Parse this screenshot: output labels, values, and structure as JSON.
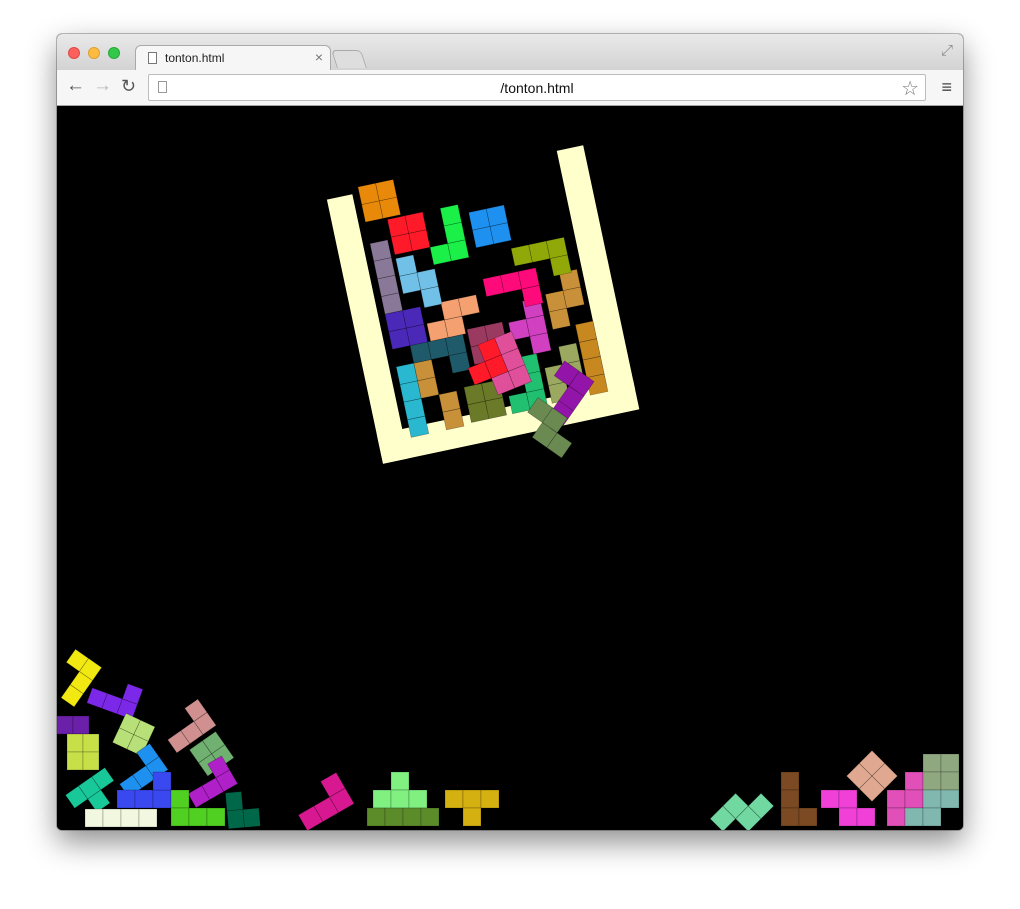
{
  "tab": {
    "title": "tonton.html",
    "close_glyph": "×"
  },
  "address_bar": {
    "url": "/tonton.html"
  },
  "icons": {
    "back": "←",
    "forward": "→",
    "reload": "↻",
    "bookmark_star": "☆",
    "menu": "≡",
    "fullscreen": "⤢"
  },
  "colors": {
    "background": "#000000",
    "container": "#ffffcc",
    "piece_palette": [
      "#e8890a",
      "#ff1a2a",
      "#e0509a",
      "#9314a8",
      "#6a8a52",
      "#1e90f0",
      "#90a808",
      "#ff0a7a",
      "#4a28b8",
      "#9a3a60",
      "#1e5a6a",
      "#c89038",
      "#2ab8d0",
      "#6a7a28",
      "#20c070",
      "#f2e812",
      "#7c28e8",
      "#b8e078",
      "#d09090",
      "#5c6c2a",
      "#7c4a22",
      "#e0a890"
    ]
  }
}
